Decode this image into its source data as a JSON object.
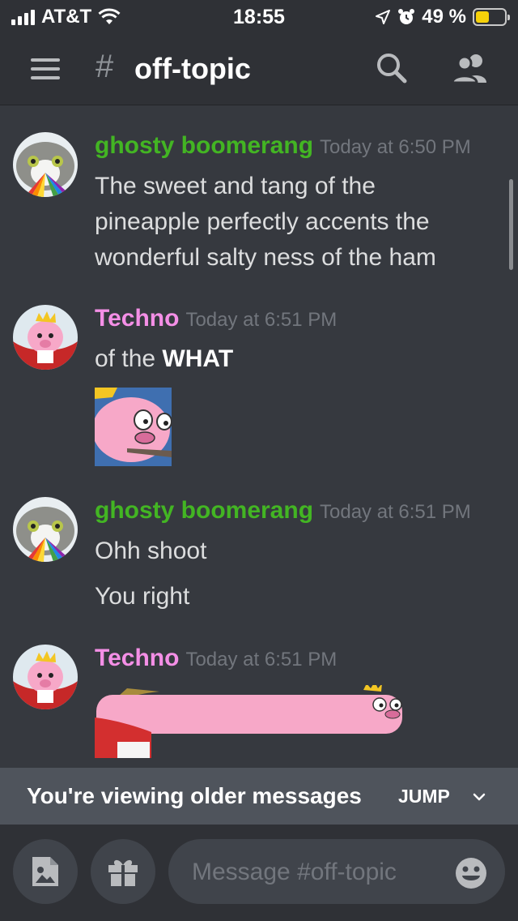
{
  "status_bar": {
    "carrier": "AT&T",
    "time": "18:55",
    "battery_percent": "49 %",
    "icons": [
      "signal-bars-icon",
      "wifi-icon",
      "location-arrow-icon",
      "alarm-icon",
      "battery-icon"
    ],
    "battery_level": 0.49,
    "battery_color": "#f5d10a"
  },
  "header": {
    "hash": "#",
    "channel": "off-topic",
    "icons": [
      "hamburger-menu-icon",
      "search-icon",
      "members-icon"
    ]
  },
  "messages": [
    {
      "username": "ghosty boomerang",
      "user_color": "#43b523",
      "timestamp": "Today at 6:50 PM",
      "lines": [
        "The sweet and tang of the",
        "pineapple perfectly accents the",
        "wonderful salty ness of the ham"
      ]
    },
    {
      "username": "Techno",
      "user_color": "#f48fe6",
      "timestamp": "Today at 6:51 PM",
      "text_plain": "of the",
      "text_bold": "WHAT",
      "attachment": "pig-emote-image"
    },
    {
      "username": "ghosty boomerang",
      "user_color": "#43b523",
      "timestamp": "Today at 6:51 PM",
      "lines": [
        "Ohh shoot",
        "You right"
      ]
    },
    {
      "username": "Techno",
      "user_color": "#f48fe6",
      "timestamp": "Today at 6:51 PM",
      "attachment": "long-pig-image"
    }
  ],
  "older_bar": {
    "text": "You're viewing older messages",
    "jump_label": "JUMP"
  },
  "composer": {
    "placeholder": "Message #off-topic",
    "icons": [
      "image-icon",
      "gift-icon",
      "emoji-icon"
    ]
  },
  "colors": {
    "background": "#36393f",
    "header_bg": "#2f3136",
    "older_bar_bg": "#4f545c"
  }
}
